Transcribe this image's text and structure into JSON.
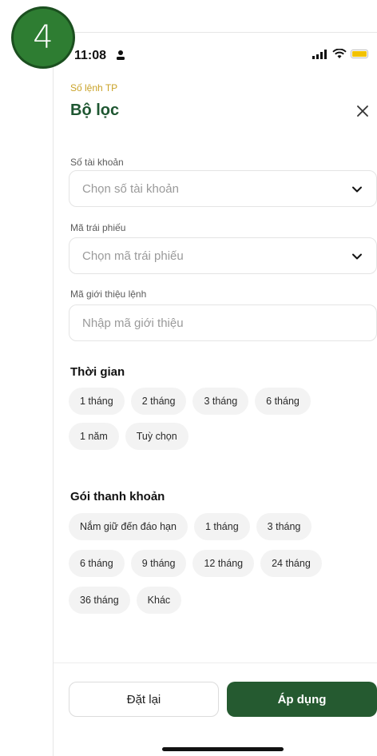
{
  "step_badge": "4",
  "status": {
    "time": "11:08"
  },
  "header": {
    "breadcrumb": "Số lệnh TP",
    "title": "Bộ lọc"
  },
  "fields": {
    "account": {
      "label": "Số tài khoản",
      "placeholder": "Chọn số tài khoản"
    },
    "bond": {
      "label": "Mã trái phiếu",
      "placeholder": "Chọn mã trái phiếu"
    },
    "referral": {
      "label": "Mã giới thiệu lệnh",
      "placeholder": "Nhập mã giới thiệu"
    }
  },
  "time_section": {
    "title": "Thời gian",
    "chips": [
      "1 tháng",
      "2 tháng",
      "3 tháng",
      "6 tháng",
      "1 năm",
      "Tuỳ chọn"
    ]
  },
  "liquidity_section": {
    "title": "Gói thanh khoản",
    "chips": [
      "Nắm giữ đến đáo hạn",
      "1 tháng",
      "3 tháng",
      "6 tháng",
      "9 tháng",
      "12 tháng",
      "24 tháng",
      "36 tháng",
      "Khác"
    ]
  },
  "footer": {
    "reset_label": "Đặt lại",
    "apply_label": "Áp dụng"
  },
  "colors": {
    "brand_green": "#1e5631",
    "button_green": "#255a30",
    "breadcrumb_gold": "#c9a227",
    "badge_green": "#2e7d32"
  },
  "icons": [
    "person-icon",
    "signal-icon",
    "wifi-icon",
    "battery-icon",
    "close-icon",
    "chevron-down-icon"
  ]
}
